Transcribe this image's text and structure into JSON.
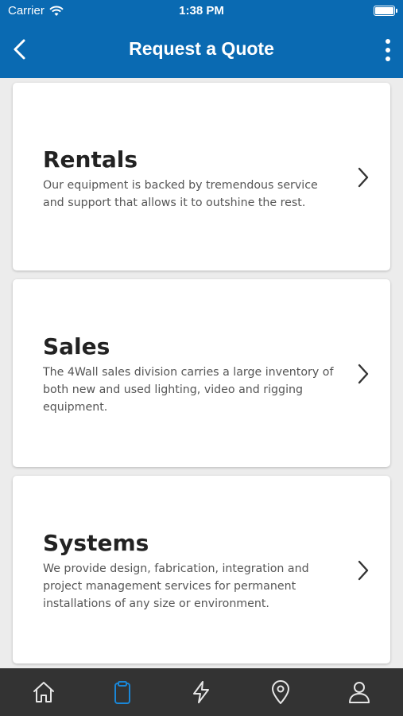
{
  "status_bar": {
    "carrier": "Carrier",
    "time": "1:38 PM"
  },
  "header": {
    "title": "Request a Quote"
  },
  "cards": [
    {
      "title": "Rentals",
      "description": "Our equipment is backed by tremendous service and support that allows it to outshine the rest."
    },
    {
      "title": "Sales",
      "description": "The 4Wall sales division carries a large inventory of both new and used lighting, video and rigging equipment."
    },
    {
      "title": "Systems",
      "description": "We provide design, fabrication, integration and project management services for permanent installations of any size or environment."
    }
  ],
  "tabbar": {
    "items": [
      {
        "icon": "home-icon",
        "active": false
      },
      {
        "icon": "clipboard-icon",
        "active": true
      },
      {
        "icon": "lightning-icon",
        "active": false
      },
      {
        "icon": "location-pin-icon",
        "active": false
      },
      {
        "icon": "profile-icon",
        "active": false
      }
    ]
  },
  "colors": {
    "primary": "#0a6ab2",
    "tab_active": "#1a87d8",
    "tab_inactive": "#e6e6e6",
    "tabbar_bg": "#333333"
  }
}
